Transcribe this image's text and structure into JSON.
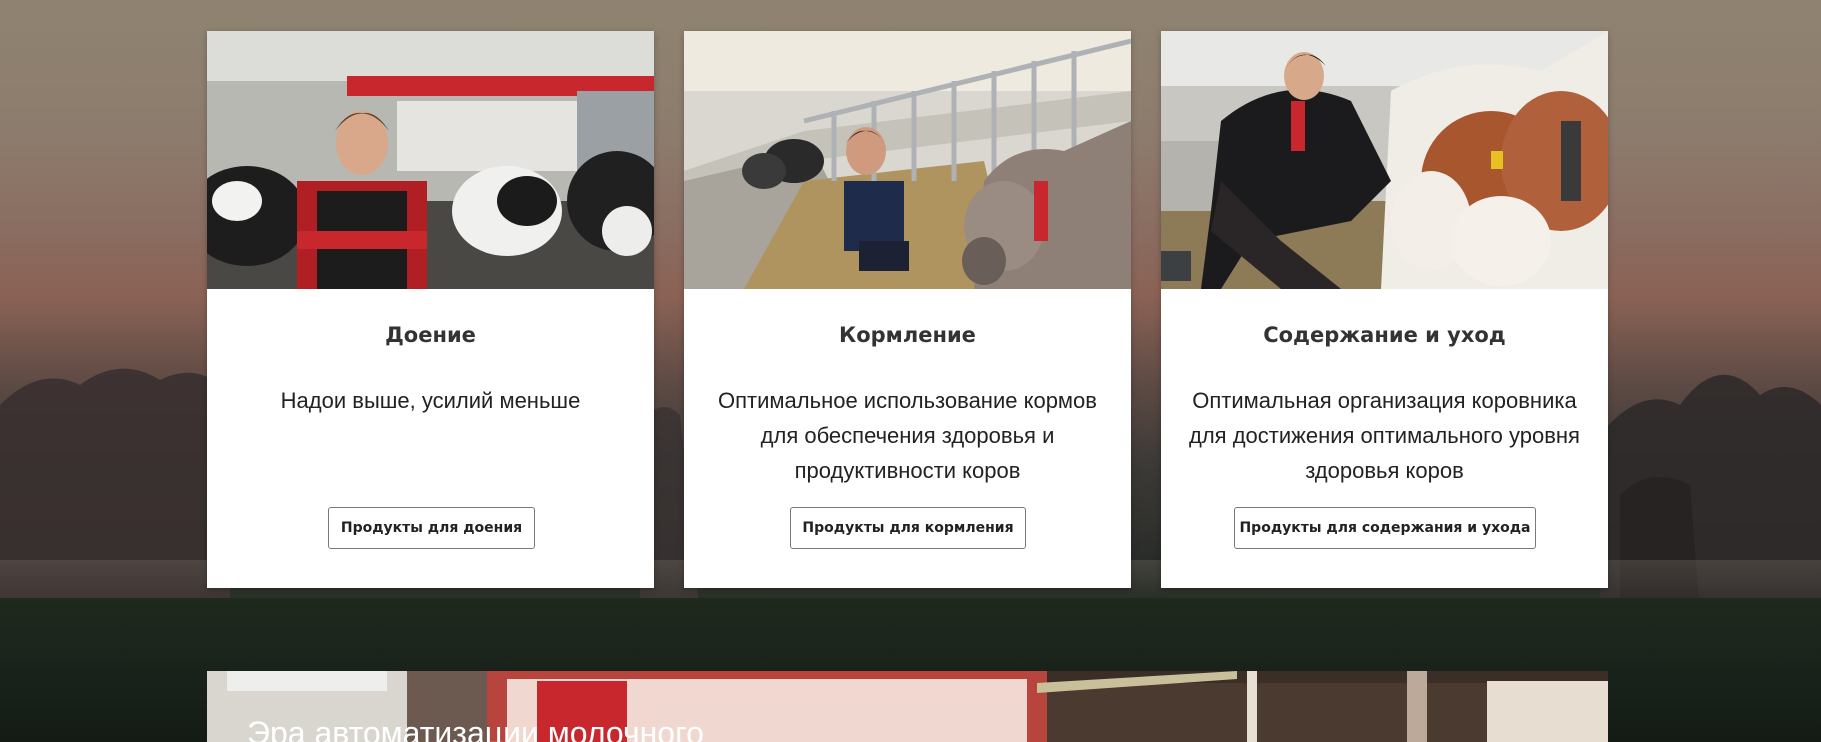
{
  "cards": [
    {
      "title": "Доение",
      "description": "Надои выше, усилий меньше",
      "button_label": "Продукты для доения",
      "image": "farmer-with-holstein-cows-milking-barn"
    },
    {
      "title": "Кормление",
      "description": "Оптимальное использование кормов для обеспечения здоровья и продуктивности коров",
      "button_label": "Продукты для кормления",
      "image": "farmer-feeding-brown-cows-feed-alley"
    },
    {
      "title": "Содержание и уход",
      "description": "Оптимальная организация коровника для достижения оптимального уровня здоровья коров",
      "button_label": "Продукты для содержания и ухода",
      "image": "woman-petting-cows-in-barn"
    }
  ],
  "banner": {
    "title": "Эра автоматизации молочного"
  },
  "colors": {
    "card_background": "#ffffff",
    "title_text": "#333333",
    "body_text": "#222222",
    "button_border": "#7a7a7a",
    "accent_red": "#c8282d"
  }
}
